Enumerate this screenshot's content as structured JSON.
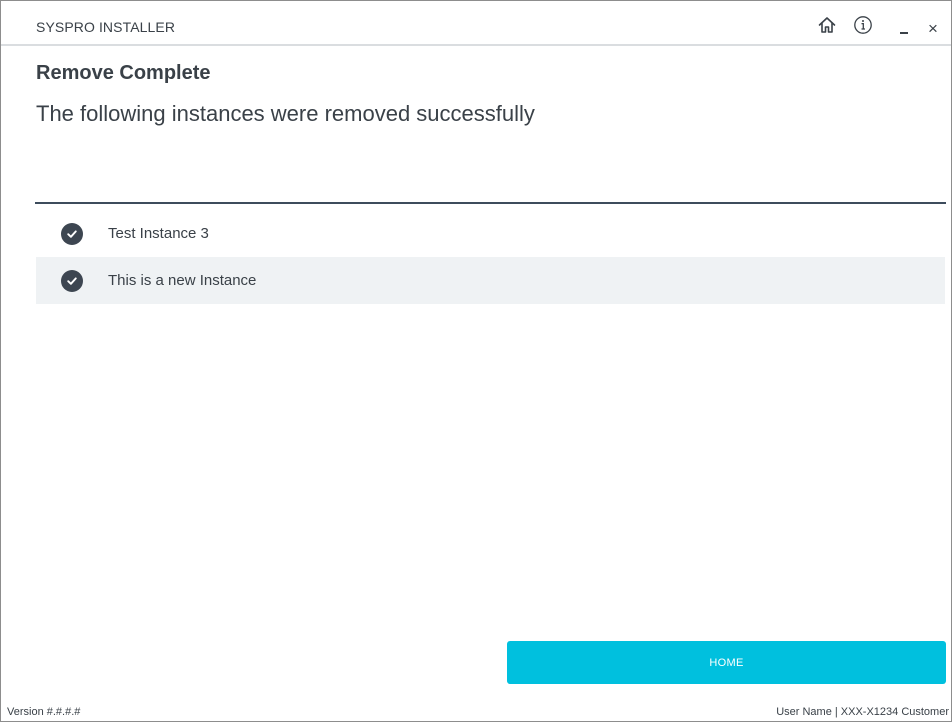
{
  "window": {
    "title": "SYSPRO INSTALLER",
    "icons": [
      "home-icon",
      "info-icon",
      "minimize-icon",
      "close-icon"
    ],
    "close_glyph": "×"
  },
  "main": {
    "heading": "Remove Complete",
    "subheading": "The following instances were removed successfully",
    "instances": [
      {
        "label": "Test Instance 3",
        "icon": "check-circle-icon"
      },
      {
        "label": "This is a new Instance",
        "icon": "check-circle-icon"
      }
    ]
  },
  "actions": {
    "home_label": "HOME"
  },
  "footer": {
    "version": "Version #.#.#.#",
    "user_info": "User Name | XXX-X1234 Customer"
  },
  "colors": {
    "accent": "#00c0de",
    "divider": "#3d4c5c",
    "check_bg": "#3d4651",
    "row_alt_bg": "#eff2f4",
    "text": "#3a4148"
  }
}
